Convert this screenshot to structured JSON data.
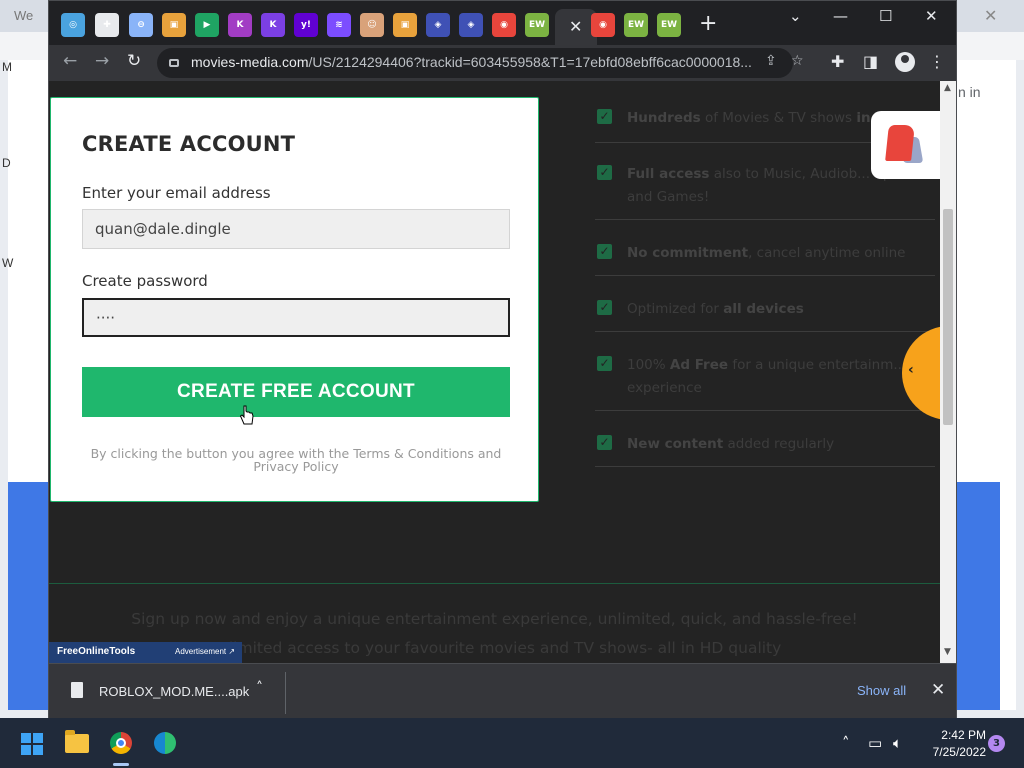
{
  "background_window": {
    "title": "We",
    "side_letters": [
      "M",
      "D",
      "W"
    ],
    "sign_in": "n in"
  },
  "tabs": [
    {
      "icon": "swirl-icon",
      "color": "#4aa3df"
    },
    {
      "icon": "puzzle-icon",
      "color": "#e8eaed"
    },
    {
      "icon": "link-icon",
      "color": "#8ab4f8"
    },
    {
      "icon": "store-icon",
      "color": "#e8a23c"
    },
    {
      "icon": "meet-icon",
      "color": "#1fa463"
    },
    {
      "icon": "k-icon",
      "color": "#a23cc4"
    },
    {
      "icon": "k-icon",
      "color": "#7b3fe4"
    },
    {
      "icon": "yahoo-icon",
      "color": "#6001d2"
    },
    {
      "icon": "layers-icon",
      "color": "#7c4dff"
    },
    {
      "icon": "avatar-icon",
      "color": "#d9a27a"
    },
    {
      "icon": "store-icon",
      "color": "#e8a23c"
    },
    {
      "icon": "shield-icon",
      "color": "#3f51b5"
    },
    {
      "icon": "shield-icon",
      "color": "#3f51b5"
    },
    {
      "icon": "record-icon",
      "color": "#e8453c"
    },
    {
      "icon": "ew-icon",
      "color": "#7cb342",
      "label": "EW"
    },
    {
      "icon": "record-icon",
      "color": "#e8453c"
    },
    {
      "icon": "ew-icon",
      "color": "#7cb342",
      "label": "EW"
    },
    {
      "icon": "ew-icon",
      "color": "#7cb342",
      "label": "EW"
    }
  ],
  "toolbar": {
    "url_host": "movies-media.com",
    "url_rest": "/US/2124294406?trackid=603455958&T1=17ebfd08ebff6cac0000018..."
  },
  "signup": {
    "title": "CREATE ACCOUNT",
    "email_label": "Enter your email address",
    "email_value": "quan@dale.dingle",
    "password_label": "Create password",
    "password_value": "····",
    "button_label": "CREATE FREE ACCOUNT",
    "terms": "By clicking the button you agree with the Terms & Conditions and Privacy Policy"
  },
  "features": [
    {
      "bold": "Hundreds",
      "text": " of Movies & TV shows ",
      "bold2": "in"
    },
    {
      "bold": "Full access",
      "text": " also to Music, Audiob... Sports and Games!",
      "bold2": ""
    },
    {
      "bold": "No commitment",
      "text": ", cancel anytime online",
      "bold2": ""
    },
    {
      "bold": "",
      "text": "Optimized for ",
      "bold2": "all devices"
    },
    {
      "bold": "",
      "text": "100% ",
      "bold2": "Ad Free",
      "tail": " for a unique entertainm... experience"
    },
    {
      "bold": "New content",
      "text": " added regularly",
      "bold2": ""
    }
  ],
  "bottom": {
    "line1": "Sign up now and enjoy a unique entertainment experience, unlimited, quick, and hassle-free!",
    "line2": "Unlimited access to your favourite movies and TV shows- all in HD quality"
  },
  "ad": {
    "brand": "FreeOnlineTools",
    "label": "Advertisement ↗"
  },
  "downloads": {
    "file_name": "ROBLOX_MOD.ME....apk",
    "show_all": "Show all"
  },
  "taskbar": {
    "time": "2:42 PM",
    "date": "7/25/2022",
    "notifications": "3"
  }
}
